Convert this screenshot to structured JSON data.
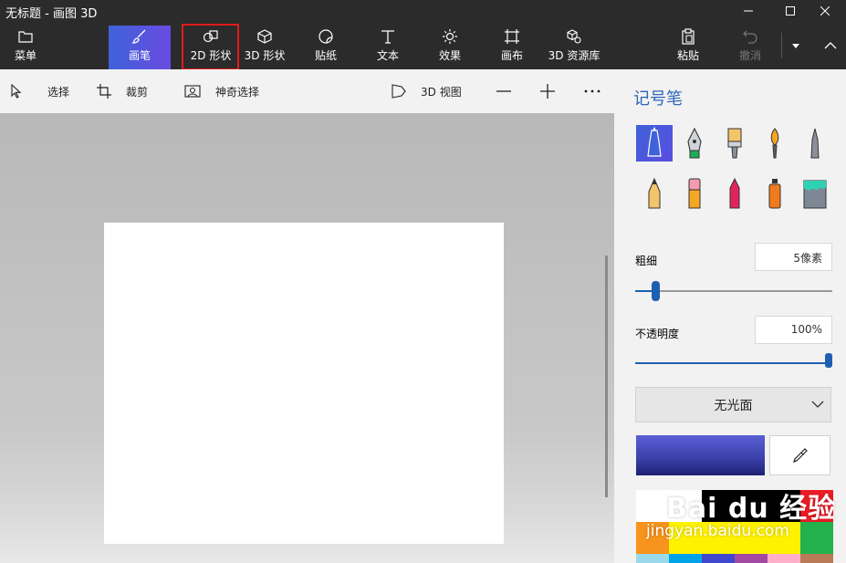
{
  "window": {
    "title": "无标题 - 画图 3D"
  },
  "ribbon": {
    "menu_label": "菜单",
    "tabs": [
      {
        "label": "画笔",
        "icon": "brush-icon",
        "active": true
      },
      {
        "label": "2D 形状",
        "icon": "shapes-2d-icon"
      },
      {
        "label": "3D 形状",
        "icon": "cube-icon"
      },
      {
        "label": "贴纸",
        "icon": "sticker-icon"
      },
      {
        "label": "文本",
        "icon": "text-icon"
      },
      {
        "label": "效果",
        "icon": "effects-sun-icon"
      },
      {
        "label": "画布",
        "icon": "canvas-crop-icon"
      },
      {
        "label": "3D 资源库",
        "icon": "3d-library-icon"
      }
    ],
    "paste_label": "粘贴",
    "undo_label": "撤消"
  },
  "toolbar": {
    "select_label": "选择",
    "crop_label": "裁剪",
    "magic_select_label": "神奇选择",
    "view3d_label": "3D 视图"
  },
  "panel": {
    "title": "记号笔",
    "brushes": [
      "marker",
      "calligraphy-pen",
      "oil-brush",
      "watercolor",
      "pixel-pen",
      "pencil",
      "eraser",
      "crayon",
      "spray-can",
      "fill-bucket"
    ],
    "thickness_label": "粗细",
    "thickness_value": "5像素",
    "thickness_level": 0.05,
    "opacity_label": "不透明度",
    "opacity_value": "100%",
    "opacity_level": 1.0,
    "finish_label": "无光面",
    "current_color": "#3a3fa8",
    "palette": [
      "#ffffff",
      "#ffffff",
      "#000000",
      "#000000",
      "#000000",
      "#ed1c24",
      "#f7941d",
      "#fff200",
      "#fff200",
      "#fff200",
      "#fff200",
      "#22b14c",
      "#99d9ea",
      "#00a2e8",
      "#3f48cc",
      "#a349a4",
      "#ffaec9",
      "#b97a57"
    ]
  },
  "watermark": {
    "brand": "Bai du 经验",
    "url": "jingyan.baidu.com"
  },
  "colors": {
    "accent": "#3e62d9",
    "highlight_box": "#e11b1b"
  }
}
